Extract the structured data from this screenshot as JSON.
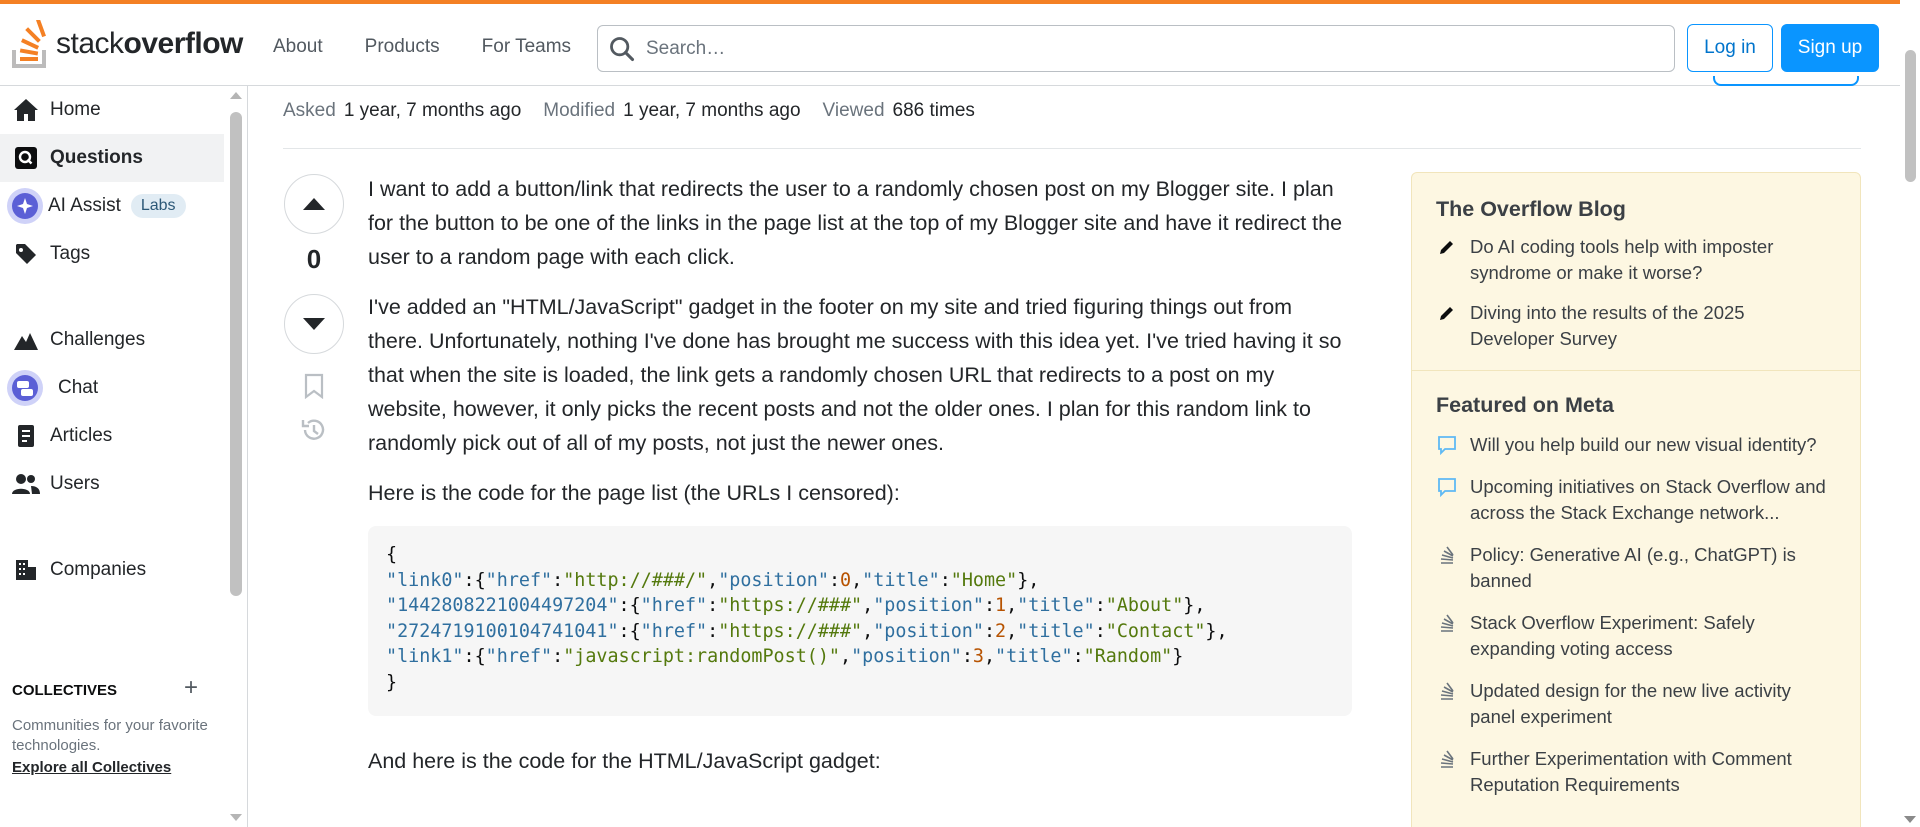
{
  "header": {
    "logo_text_light": "stack",
    "logo_text_bold": "overflow",
    "nav": [
      "About",
      "Products",
      "For Teams"
    ],
    "search_placeholder": "Search…",
    "login_label": "Log in",
    "signup_label": "Sign up"
  },
  "sidebar": {
    "items": [
      {
        "label": "Home",
        "icon": "home-icon"
      },
      {
        "label": "Questions",
        "icon": "questions-icon",
        "active": true
      },
      {
        "label": "AI Assist",
        "icon": "ai-assist-icon",
        "badge": "Labs"
      },
      {
        "label": "Tags",
        "icon": "tag-icon"
      },
      {
        "label": "Challenges",
        "icon": "challenges-icon"
      },
      {
        "label": "Chat",
        "icon": "chat-icon"
      },
      {
        "label": "Articles",
        "icon": "articles-icon"
      },
      {
        "label": "Users",
        "icon": "users-icon"
      },
      {
        "label": "Companies",
        "icon": "companies-icon"
      }
    ],
    "collectives": {
      "heading": "COLLECTIVES",
      "description": "Communities for your favorite technologies.",
      "link": "Explore all Collectives"
    }
  },
  "question": {
    "asked_label": "Asked",
    "asked_value": "1 year, 7 months ago",
    "modified_label": "Modified",
    "modified_value": "1 year, 7 months ago",
    "viewed_label": "Viewed",
    "viewed_value": "686 times",
    "vote_count": "0",
    "paragraphs": [
      "I want to add a button/link that redirects the user to a randomly chosen post on my Blogger site. I plan for the button to be one of the links in the page list at the top of my Blogger site and have it redirect the user to a random page with each click.",
      "I've added an \"HTML/JavaScript\" gadget in the footer on my site and tried figuring things out from there. Unfortunately, nothing I've done has brought me success with this idea yet. I've tried having it so that when the site is loaded, the link gets a randomly chosen URL that redirects to a post on my website, however, it only picks the recent posts and not the older ones. I plan for this random link to randomly pick out of all of my posts, not just the newer ones.",
      "Here is the code for the page list (the URLs I censored):",
      "And here is the code for the HTML/JavaScript gadget:"
    ],
    "code_lines": [
      [
        {
          "t": "{",
          "c": "pun"
        }
      ],
      [
        {
          "t": "\"link0\"",
          "c": "key"
        },
        {
          "t": ":{",
          "c": "pun"
        },
        {
          "t": "\"href\"",
          "c": "key"
        },
        {
          "t": ":",
          "c": "pun"
        },
        {
          "t": "\"http://###/\"",
          "c": "str"
        },
        {
          "t": ",",
          "c": "pun"
        },
        {
          "t": "\"position\"",
          "c": "key"
        },
        {
          "t": ":",
          "c": "pun"
        },
        {
          "t": "0",
          "c": "num"
        },
        {
          "t": ",",
          "c": "pun"
        },
        {
          "t": "\"title\"",
          "c": "key"
        },
        {
          "t": ":",
          "c": "pun"
        },
        {
          "t": "\"Home\"",
          "c": "str"
        },
        {
          "t": "},",
          "c": "pun"
        }
      ],
      [
        {
          "t": "\"1442808221004497204\"",
          "c": "key"
        },
        {
          "t": ":{",
          "c": "pun"
        },
        {
          "t": "\"href\"",
          "c": "key"
        },
        {
          "t": ":",
          "c": "pun"
        },
        {
          "t": "\"https://###\"",
          "c": "str"
        },
        {
          "t": ",",
          "c": "pun"
        },
        {
          "t": "\"position\"",
          "c": "key"
        },
        {
          "t": ":",
          "c": "pun"
        },
        {
          "t": "1",
          "c": "num"
        },
        {
          "t": ",",
          "c": "pun"
        },
        {
          "t": "\"title\"",
          "c": "key"
        },
        {
          "t": ":",
          "c": "pun"
        },
        {
          "t": "\"About\"",
          "c": "str"
        },
        {
          "t": "},",
          "c": "pun"
        }
      ],
      [
        {
          "t": "\"2724719100104741041\"",
          "c": "key"
        },
        {
          "t": ":{",
          "c": "pun"
        },
        {
          "t": "\"href\"",
          "c": "key"
        },
        {
          "t": ":",
          "c": "pun"
        },
        {
          "t": "\"https://###\"",
          "c": "str"
        },
        {
          "t": ",",
          "c": "pun"
        },
        {
          "t": "\"position\"",
          "c": "key"
        },
        {
          "t": ":",
          "c": "pun"
        },
        {
          "t": "2",
          "c": "num"
        },
        {
          "t": ",",
          "c": "pun"
        },
        {
          "t": "\"title\"",
          "c": "key"
        },
        {
          "t": ":",
          "c": "pun"
        },
        {
          "t": "\"Contact\"",
          "c": "str"
        },
        {
          "t": "},",
          "c": "pun"
        }
      ],
      [
        {
          "t": "\"link1\"",
          "c": "key"
        },
        {
          "t": ":{",
          "c": "pun"
        },
        {
          "t": "\"href\"",
          "c": "key"
        },
        {
          "t": ":",
          "c": "pun"
        },
        {
          "t": "\"javascript:randomPost()\"",
          "c": "str"
        },
        {
          "t": ",",
          "c": "pun"
        },
        {
          "t": "\"position\"",
          "c": "key"
        },
        {
          "t": ":",
          "c": "pun"
        },
        {
          "t": "3",
          "c": "num"
        },
        {
          "t": ",",
          "c": "pun"
        },
        {
          "t": "\"title\"",
          "c": "key"
        },
        {
          "t": ":",
          "c": "pun"
        },
        {
          "t": "\"Random\"",
          "c": "str"
        },
        {
          "t": "}",
          "c": "pun"
        }
      ],
      [
        {
          "t": "}",
          "c": "pun"
        }
      ]
    ]
  },
  "right_sidebar": {
    "blog_heading": "The Overflow Blog",
    "blog_items": [
      {
        "text": "Do AI coding tools help with imposter syndrome or make it worse?",
        "icon": "pencil-icon"
      },
      {
        "text": "Diving into the results of the 2025 Developer Survey",
        "icon": "pencil-icon"
      }
    ],
    "meta_heading": "Featured on Meta",
    "meta_items": [
      {
        "text": "Will you help build our new visual identity?",
        "icon": "comment-icon"
      },
      {
        "text": "Upcoming initiatives on Stack Overflow and across the Stack Exchange network...",
        "icon": "comment-icon"
      },
      {
        "text": "Policy: Generative AI (e.g., ChatGPT) is banned",
        "icon": "stack-exchange-icon"
      },
      {
        "text": "Stack Overflow Experiment: Safely expanding voting access",
        "icon": "stack-exchange-icon"
      },
      {
        "text": "Updated design for the new live activity panel experiment",
        "icon": "stack-exchange-icon"
      },
      {
        "text": "Further Experimentation with Comment Reputation Requirements",
        "icon": "stack-exchange-icon"
      }
    ]
  },
  "colors": {
    "accent_orange": "#f48024",
    "link_blue": "#0a95ff",
    "sidebar_yellow": "#fdf7e2"
  }
}
